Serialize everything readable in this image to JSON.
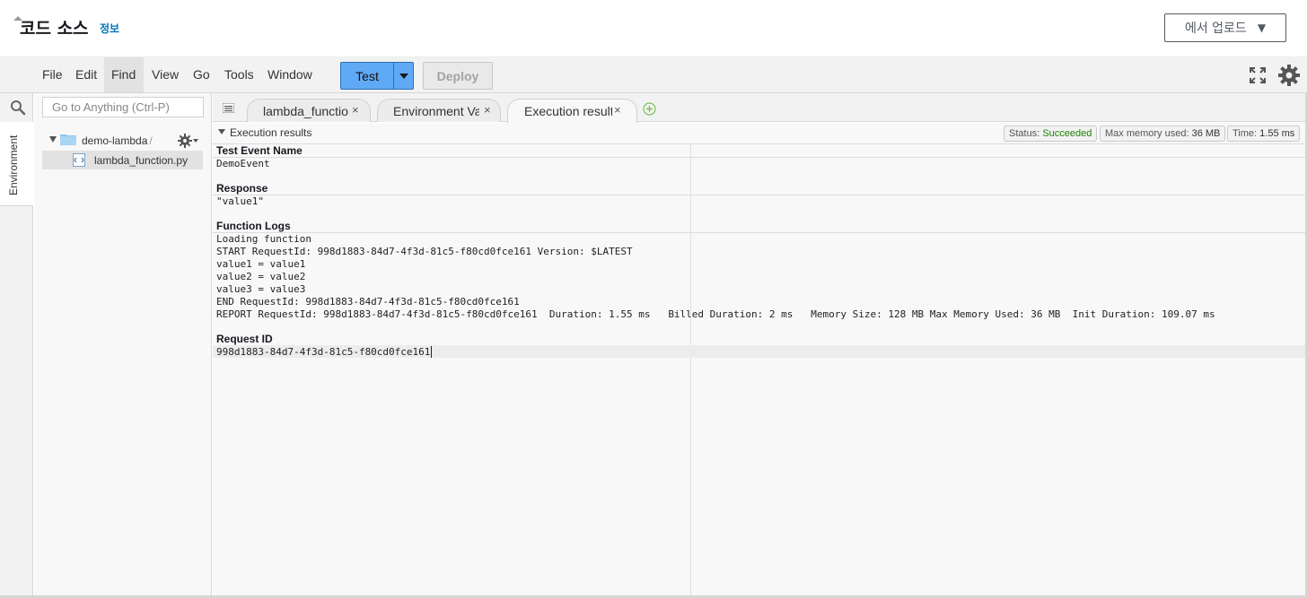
{
  "header": {
    "title": "코드 소스",
    "info_link": "정보",
    "upload_button": "에서 업로드"
  },
  "menu": {
    "items": [
      "File",
      "Edit",
      "Find",
      "View",
      "Go",
      "Tools",
      "Window"
    ],
    "active": "Find",
    "test_label": "Test",
    "deploy_label": "Deploy"
  },
  "sidebar": {
    "environment_tab": "Environment",
    "search_placeholder": "Go to Anything (Ctrl-P)",
    "folder": "demo-lambda",
    "folder_sep": "/",
    "file": "lambda_function.py"
  },
  "tabs": [
    {
      "label": "lambda_function",
      "close": "×"
    },
    {
      "label": "Environment Var",
      "close": "×"
    },
    {
      "label": "Execution results",
      "close": "×"
    }
  ],
  "results": {
    "header": "Execution results",
    "status_label": "Status:",
    "status_value": "Succeeded",
    "memory_label": "Max memory used:",
    "memory_value": "36 MB",
    "time_label": "Time:",
    "time_value": "1.55 ms",
    "test_event_title": "Test Event Name",
    "test_event_value": "DemoEvent",
    "response_title": "Response",
    "response_value": "\"value1\"",
    "logs_title": "Function Logs",
    "logs": [
      "Loading function",
      "START RequestId: 998d1883-84d7-4f3d-81c5-f80cd0fce161 Version: $LATEST",
      "value1 = value1",
      "value2 = value2",
      "value3 = value3",
      "END RequestId: 998d1883-84d7-4f3d-81c5-f80cd0fce161",
      "REPORT RequestId: 998d1883-84d7-4f3d-81c5-f80cd0fce161  Duration: 1.55 ms   Billed Duration: 2 ms   Memory Size: 128 MB Max Memory Used: 36 MB  Init Duration: 109.07 ms"
    ],
    "request_id_title": "Request ID",
    "request_id_value": "998d1883-84d7-4f3d-81c5-f80cd0fce161"
  },
  "colors": {
    "accent": "#60a9f5",
    "link": "#0073bb",
    "success": "#1d8102"
  }
}
